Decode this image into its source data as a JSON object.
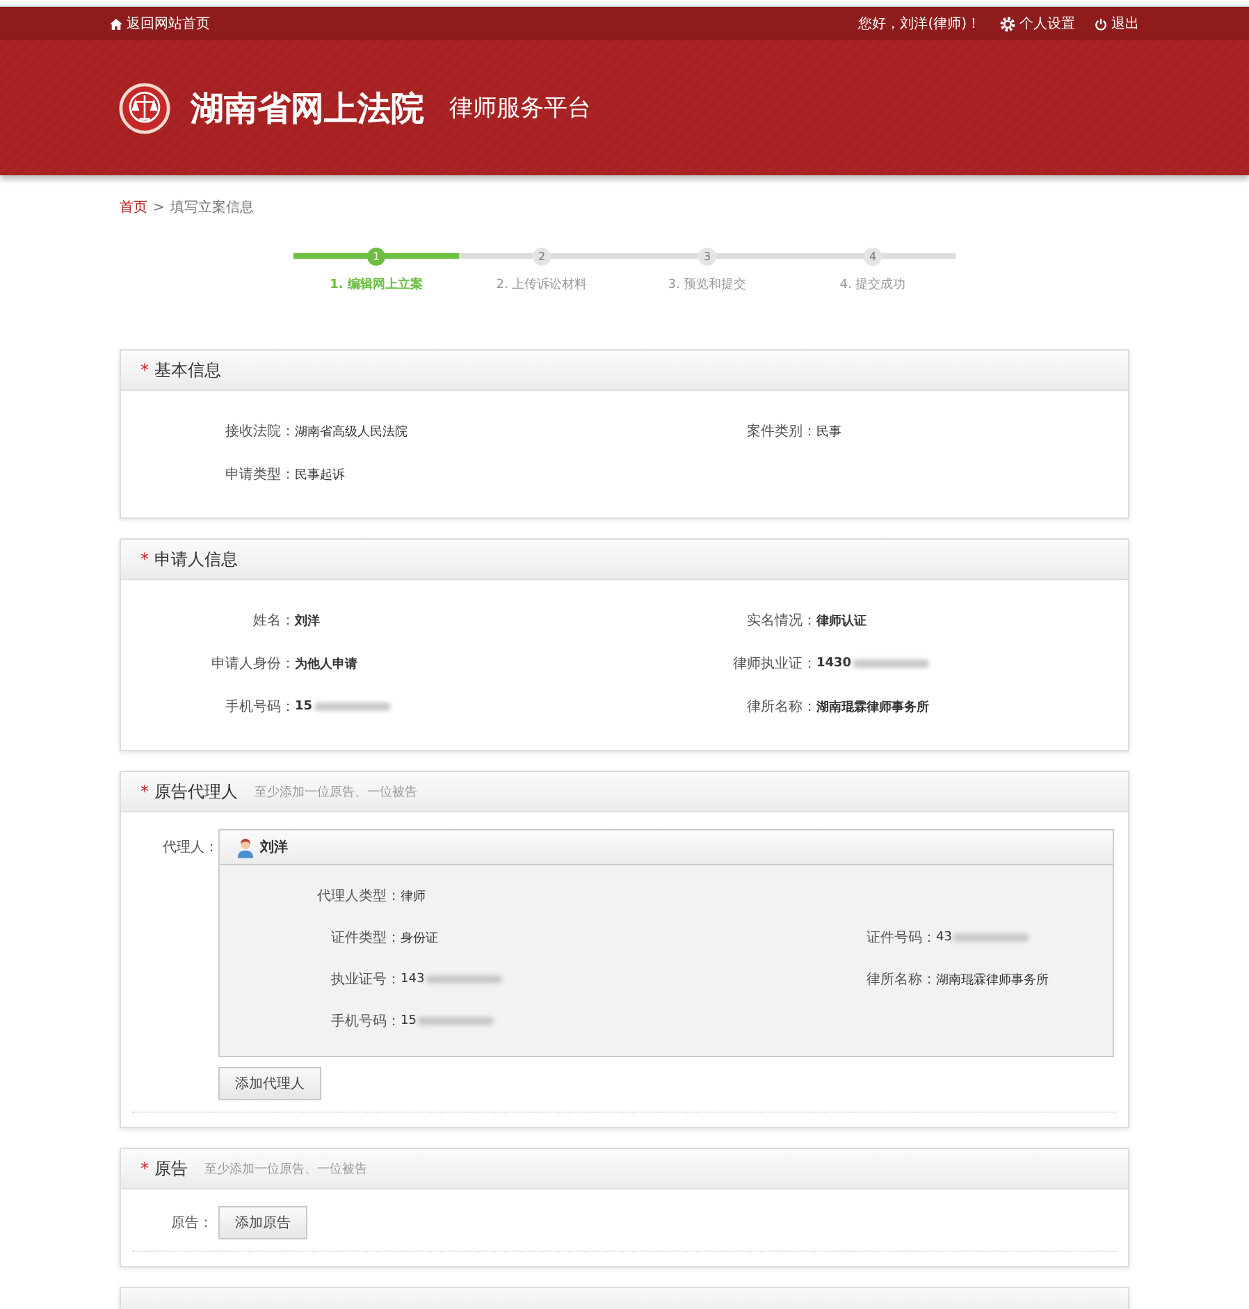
{
  "topbar": {
    "home_link": "返回网站首页",
    "greeting": "您好，刘洋(律师)！",
    "settings": "个人设置",
    "logout": "退出"
  },
  "header": {
    "title": "湖南省网上法院",
    "subtitle": "律师服务平台"
  },
  "breadcrumb": {
    "home": "首页",
    "separator": ">",
    "current": "填写立案信息"
  },
  "steps": [
    {
      "number": "1",
      "label": "1. 编辑网上立案",
      "selected": true
    },
    {
      "number": "2",
      "label": "2. 上传诉讼材料",
      "selected": false
    },
    {
      "number": "3",
      "label": "3. 预览和提交",
      "selected": false
    },
    {
      "number": "4",
      "label": "4. 提交成功",
      "selected": false
    }
  ],
  "basic_info": {
    "required_mark": "*",
    "title": "基本信息",
    "rows": [
      [
        {
          "label": "接收法院：",
          "value": "湖南省高级人民法院"
        },
        {
          "label": "案件类别：",
          "value": "民事"
        }
      ],
      [
        {
          "label": "申请类型：",
          "value": "民事起诉"
        }
      ]
    ]
  },
  "applicant_info": {
    "required_mark": "*",
    "title": "申请人信息",
    "rows": [
      [
        {
          "label": "姓名：",
          "value": "刘洋"
        },
        {
          "label": "实名情况：",
          "value": "律师认证"
        }
      ],
      [
        {
          "label": "申请人身份：",
          "value": "为他人申请"
        },
        {
          "label": "律师执业证：",
          "value": "1430",
          "redacted": true
        }
      ],
      [
        {
          "label": "手机号码：",
          "value": "15",
          "redacted": true
        },
        {
          "label": "律所名称：",
          "value": "湖南琨霖律师事务所"
        }
      ]
    ]
  },
  "plaintiff_agent": {
    "required_mark": "*",
    "title": "原告代理人",
    "hint": "至少添加一位原告、一位被告",
    "field_label": "代理人：",
    "agent": {
      "name": "刘洋",
      "rows": [
        [
          {
            "label": "代理人类型：",
            "value": "律师"
          }
        ],
        [
          {
            "label": "证件类型：",
            "value": "身份证"
          },
          {
            "label": "证件号码：",
            "value": "43",
            "redacted": true
          }
        ],
        [
          {
            "label": "执业证号：",
            "value": "143",
            "redacted": true
          },
          {
            "label": "律所名称：",
            "value": "湖南琨霖律师事务所"
          }
        ],
        [
          {
            "label": "手机号码：",
            "value": "15",
            "redacted": true
          }
        ]
      ]
    },
    "add_button": "添加代理人"
  },
  "plaintiff": {
    "required_mark": "*",
    "title": "原告",
    "hint": "至少添加一位原告、一位被告",
    "field_label": "原告：",
    "add_button": "添加原告"
  }
}
